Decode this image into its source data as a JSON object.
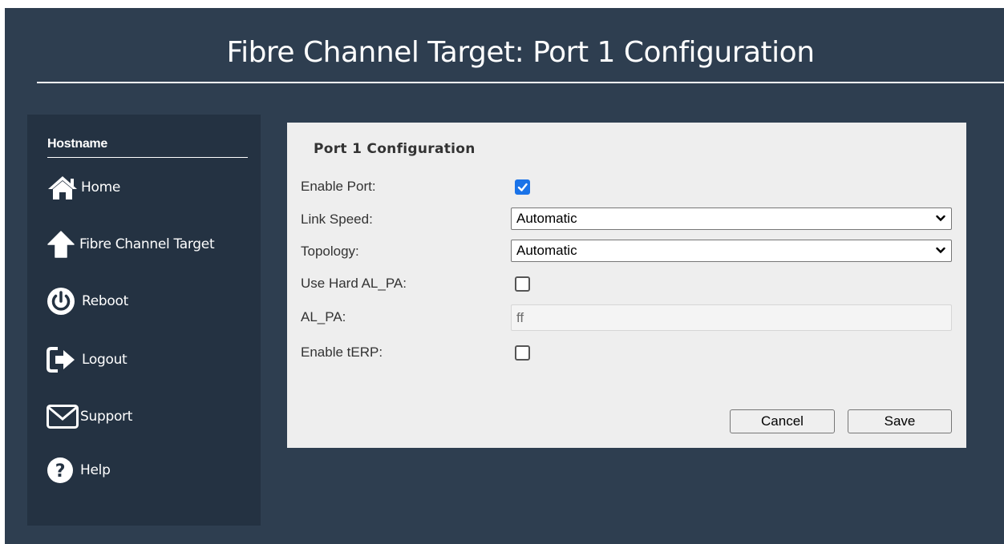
{
  "header": {
    "title": "Fibre Channel Target: Port 1 Configuration"
  },
  "sidebar": {
    "header": "Hostname",
    "items": [
      {
        "label": "Home",
        "icon": "home-icon"
      },
      {
        "label": "Fibre Channel Target",
        "icon": "arrow-up-icon"
      },
      {
        "label": "Reboot",
        "icon": "power-icon"
      },
      {
        "label": "Logout",
        "icon": "logout-icon"
      },
      {
        "label": "Support",
        "icon": "envelope-icon"
      },
      {
        "label": "Help",
        "icon": "question-icon"
      }
    ]
  },
  "form": {
    "title": "Port 1 Configuration",
    "enable_port": {
      "label": "Enable Port:",
      "checked": true
    },
    "link_speed": {
      "label": "Link Speed:",
      "value": "Automatic"
    },
    "topology": {
      "label": "Topology:",
      "value": "Automatic"
    },
    "use_hard_al_pa": {
      "label": "Use Hard AL_PA:",
      "checked": false
    },
    "al_pa": {
      "label": "AL_PA:",
      "value": "ff",
      "disabled": true
    },
    "enable_terp": {
      "label": "Enable tERP:",
      "checked": false
    },
    "cancel_label": "Cancel",
    "save_label": "Save"
  },
  "colors": {
    "background": "#2e3e50",
    "sidebar": "#243242",
    "card": "#eeeeee",
    "checkbox_accent": "#1a73e8"
  }
}
